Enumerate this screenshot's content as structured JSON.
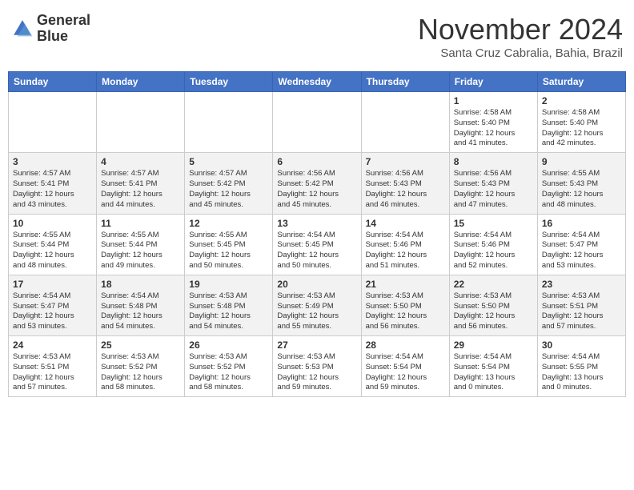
{
  "header": {
    "logo_line1": "General",
    "logo_line2": "Blue",
    "month_title": "November 2024",
    "location": "Santa Cruz Cabralia, Bahia, Brazil"
  },
  "weekdays": [
    "Sunday",
    "Monday",
    "Tuesday",
    "Wednesday",
    "Thursday",
    "Friday",
    "Saturday"
  ],
  "weeks": [
    [
      {
        "day": "",
        "info": ""
      },
      {
        "day": "",
        "info": ""
      },
      {
        "day": "",
        "info": ""
      },
      {
        "day": "",
        "info": ""
      },
      {
        "day": "",
        "info": ""
      },
      {
        "day": "1",
        "info": "Sunrise: 4:58 AM\nSunset: 5:40 PM\nDaylight: 12 hours\nand 41 minutes."
      },
      {
        "day": "2",
        "info": "Sunrise: 4:58 AM\nSunset: 5:40 PM\nDaylight: 12 hours\nand 42 minutes."
      }
    ],
    [
      {
        "day": "3",
        "info": "Sunrise: 4:57 AM\nSunset: 5:41 PM\nDaylight: 12 hours\nand 43 minutes."
      },
      {
        "day": "4",
        "info": "Sunrise: 4:57 AM\nSunset: 5:41 PM\nDaylight: 12 hours\nand 44 minutes."
      },
      {
        "day": "5",
        "info": "Sunrise: 4:57 AM\nSunset: 5:42 PM\nDaylight: 12 hours\nand 45 minutes."
      },
      {
        "day": "6",
        "info": "Sunrise: 4:56 AM\nSunset: 5:42 PM\nDaylight: 12 hours\nand 45 minutes."
      },
      {
        "day": "7",
        "info": "Sunrise: 4:56 AM\nSunset: 5:43 PM\nDaylight: 12 hours\nand 46 minutes."
      },
      {
        "day": "8",
        "info": "Sunrise: 4:56 AM\nSunset: 5:43 PM\nDaylight: 12 hours\nand 47 minutes."
      },
      {
        "day": "9",
        "info": "Sunrise: 4:55 AM\nSunset: 5:43 PM\nDaylight: 12 hours\nand 48 minutes."
      }
    ],
    [
      {
        "day": "10",
        "info": "Sunrise: 4:55 AM\nSunset: 5:44 PM\nDaylight: 12 hours\nand 48 minutes."
      },
      {
        "day": "11",
        "info": "Sunrise: 4:55 AM\nSunset: 5:44 PM\nDaylight: 12 hours\nand 49 minutes."
      },
      {
        "day": "12",
        "info": "Sunrise: 4:55 AM\nSunset: 5:45 PM\nDaylight: 12 hours\nand 50 minutes."
      },
      {
        "day": "13",
        "info": "Sunrise: 4:54 AM\nSunset: 5:45 PM\nDaylight: 12 hours\nand 50 minutes."
      },
      {
        "day": "14",
        "info": "Sunrise: 4:54 AM\nSunset: 5:46 PM\nDaylight: 12 hours\nand 51 minutes."
      },
      {
        "day": "15",
        "info": "Sunrise: 4:54 AM\nSunset: 5:46 PM\nDaylight: 12 hours\nand 52 minutes."
      },
      {
        "day": "16",
        "info": "Sunrise: 4:54 AM\nSunset: 5:47 PM\nDaylight: 12 hours\nand 53 minutes."
      }
    ],
    [
      {
        "day": "17",
        "info": "Sunrise: 4:54 AM\nSunset: 5:47 PM\nDaylight: 12 hours\nand 53 minutes."
      },
      {
        "day": "18",
        "info": "Sunrise: 4:54 AM\nSunset: 5:48 PM\nDaylight: 12 hours\nand 54 minutes."
      },
      {
        "day": "19",
        "info": "Sunrise: 4:53 AM\nSunset: 5:48 PM\nDaylight: 12 hours\nand 54 minutes."
      },
      {
        "day": "20",
        "info": "Sunrise: 4:53 AM\nSunset: 5:49 PM\nDaylight: 12 hours\nand 55 minutes."
      },
      {
        "day": "21",
        "info": "Sunrise: 4:53 AM\nSunset: 5:50 PM\nDaylight: 12 hours\nand 56 minutes."
      },
      {
        "day": "22",
        "info": "Sunrise: 4:53 AM\nSunset: 5:50 PM\nDaylight: 12 hours\nand 56 minutes."
      },
      {
        "day": "23",
        "info": "Sunrise: 4:53 AM\nSunset: 5:51 PM\nDaylight: 12 hours\nand 57 minutes."
      }
    ],
    [
      {
        "day": "24",
        "info": "Sunrise: 4:53 AM\nSunset: 5:51 PM\nDaylight: 12 hours\nand 57 minutes."
      },
      {
        "day": "25",
        "info": "Sunrise: 4:53 AM\nSunset: 5:52 PM\nDaylight: 12 hours\nand 58 minutes."
      },
      {
        "day": "26",
        "info": "Sunrise: 4:53 AM\nSunset: 5:52 PM\nDaylight: 12 hours\nand 58 minutes."
      },
      {
        "day": "27",
        "info": "Sunrise: 4:53 AM\nSunset: 5:53 PM\nDaylight: 12 hours\nand 59 minutes."
      },
      {
        "day": "28",
        "info": "Sunrise: 4:54 AM\nSunset: 5:54 PM\nDaylight: 12 hours\nand 59 minutes."
      },
      {
        "day": "29",
        "info": "Sunrise: 4:54 AM\nSunset: 5:54 PM\nDaylight: 13 hours\nand 0 minutes."
      },
      {
        "day": "30",
        "info": "Sunrise: 4:54 AM\nSunset: 5:55 PM\nDaylight: 13 hours\nand 0 minutes."
      }
    ]
  ]
}
